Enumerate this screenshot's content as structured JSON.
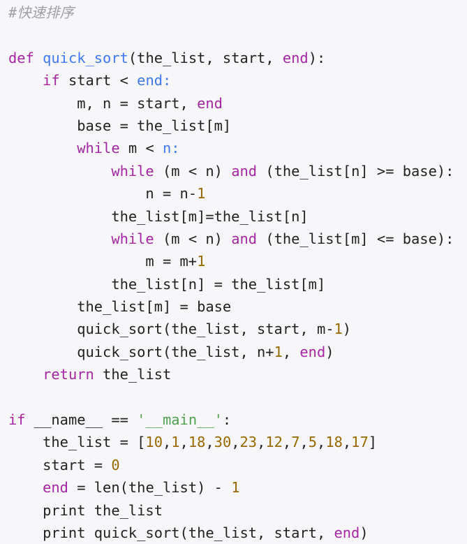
{
  "colors": {
    "keyword": "#a626a4",
    "function": "#4078f2",
    "number": "#986801",
    "string": "#50a14f",
    "comment": "#a0a1a7",
    "plain": "#222222",
    "background": "#f7f7f9"
  },
  "language": "python",
  "lines": [
    [
      [
        "cm",
        "#快速排序"
      ]
    ],
    [],
    [
      [
        "kw",
        "def"
      ],
      [
        "pl",
        " "
      ],
      [
        "fn",
        "quick_sort"
      ],
      [
        "pl",
        "(the_list, start, "
      ],
      [
        "kw",
        "end"
      ],
      [
        "pl",
        "):"
      ]
    ],
    [
      [
        "pl",
        "    "
      ],
      [
        "kw",
        "if"
      ],
      [
        "pl",
        " start < "
      ],
      [
        "fn",
        "end:"
      ]
    ],
    [
      [
        "pl",
        "        m, n = start, "
      ],
      [
        "kw",
        "end"
      ]
    ],
    [
      [
        "pl",
        "        base = the_list[m]"
      ]
    ],
    [
      [
        "pl",
        "        "
      ],
      [
        "kw",
        "while"
      ],
      [
        "pl",
        " m < "
      ],
      [
        "fn",
        "n:"
      ]
    ],
    [
      [
        "pl",
        "            "
      ],
      [
        "kw",
        "while"
      ],
      [
        "pl",
        " (m < n) "
      ],
      [
        "kw",
        "and"
      ],
      [
        "pl",
        " (the_list[n] >= base):"
      ]
    ],
    [
      [
        "pl",
        "                n = n-"
      ],
      [
        "num",
        "1"
      ]
    ],
    [
      [
        "pl",
        "            the_list[m]=the_list[n]"
      ]
    ],
    [
      [
        "pl",
        "            "
      ],
      [
        "kw",
        "while"
      ],
      [
        "pl",
        " (m < n) "
      ],
      [
        "kw",
        "and"
      ],
      [
        "pl",
        " (the_list[m] <= base):"
      ]
    ],
    [
      [
        "pl",
        "                m = m+"
      ],
      [
        "num",
        "1"
      ]
    ],
    [
      [
        "pl",
        "            the_list[n] = the_list[m]"
      ]
    ],
    [
      [
        "pl",
        "        the_list[m] = base"
      ]
    ],
    [
      [
        "pl",
        "        quick_sort(the_list, start, m-"
      ],
      [
        "num",
        "1"
      ],
      [
        "pl",
        ")"
      ]
    ],
    [
      [
        "pl",
        "        quick_sort(the_list, n+"
      ],
      [
        "num",
        "1"
      ],
      [
        "pl",
        ", "
      ],
      [
        "kw",
        "end"
      ],
      [
        "pl",
        ")"
      ]
    ],
    [
      [
        "pl",
        "    "
      ],
      [
        "kw",
        "return"
      ],
      [
        "pl",
        " the_list"
      ]
    ],
    [],
    [
      [
        "kw",
        "if"
      ],
      [
        "pl",
        " __name__ == "
      ],
      [
        "str",
        "'__main__'"
      ],
      [
        "pl",
        ":"
      ]
    ],
    [
      [
        "pl",
        "    the_list = ["
      ],
      [
        "num",
        "10"
      ],
      [
        "pl",
        ","
      ],
      [
        "num",
        "1"
      ],
      [
        "pl",
        ","
      ],
      [
        "num",
        "18"
      ],
      [
        "pl",
        ","
      ],
      [
        "num",
        "30"
      ],
      [
        "pl",
        ","
      ],
      [
        "num",
        "23"
      ],
      [
        "pl",
        ","
      ],
      [
        "num",
        "12"
      ],
      [
        "pl",
        ","
      ],
      [
        "num",
        "7"
      ],
      [
        "pl",
        ","
      ],
      [
        "num",
        "5"
      ],
      [
        "pl",
        ","
      ],
      [
        "num",
        "18"
      ],
      [
        "pl",
        ","
      ],
      [
        "num",
        "17"
      ],
      [
        "pl",
        "]"
      ]
    ],
    [
      [
        "pl",
        "    start = "
      ],
      [
        "num",
        "0"
      ]
    ],
    [
      [
        "pl",
        "    "
      ],
      [
        "kw",
        "end"
      ],
      [
        "pl",
        " = len(the_list) - "
      ],
      [
        "num",
        "1"
      ]
    ],
    [
      [
        "pl",
        "    print the_list"
      ]
    ],
    [
      [
        "pl",
        "    print quick_sort(the_list, start, "
      ],
      [
        "kw",
        "end"
      ],
      [
        "pl",
        ")"
      ]
    ]
  ]
}
